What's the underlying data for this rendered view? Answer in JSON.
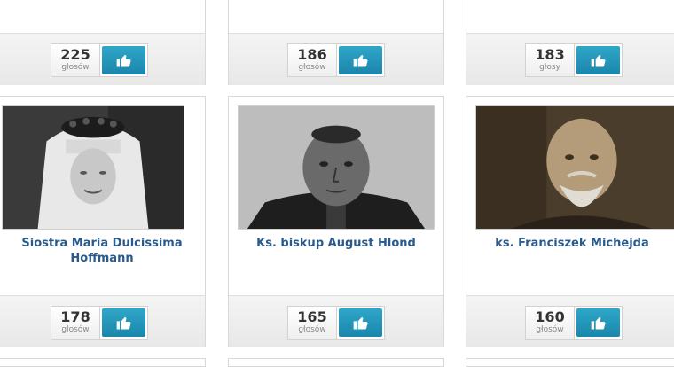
{
  "top_row": [
    {
      "votes": "225",
      "votes_label": "głosów"
    },
    {
      "votes": "186",
      "votes_label": "głosów"
    },
    {
      "votes": "183",
      "votes_label": "głosy"
    }
  ],
  "cards": [
    {
      "name": "Siostra Maria Dulcissima Hoffmann",
      "votes": "178",
      "votes_label": "głosów"
    },
    {
      "name": "Ks. biskup August Hlond",
      "votes": "165",
      "votes_label": "głosów"
    },
    {
      "name": "ks. Franciszek Michejda",
      "votes": "160",
      "votes_label": "głosów"
    }
  ],
  "icons": {
    "like": "thumbs-up-icon"
  },
  "colors": {
    "like_button": "#1f95bb",
    "name_text": "#2a5a8a"
  }
}
